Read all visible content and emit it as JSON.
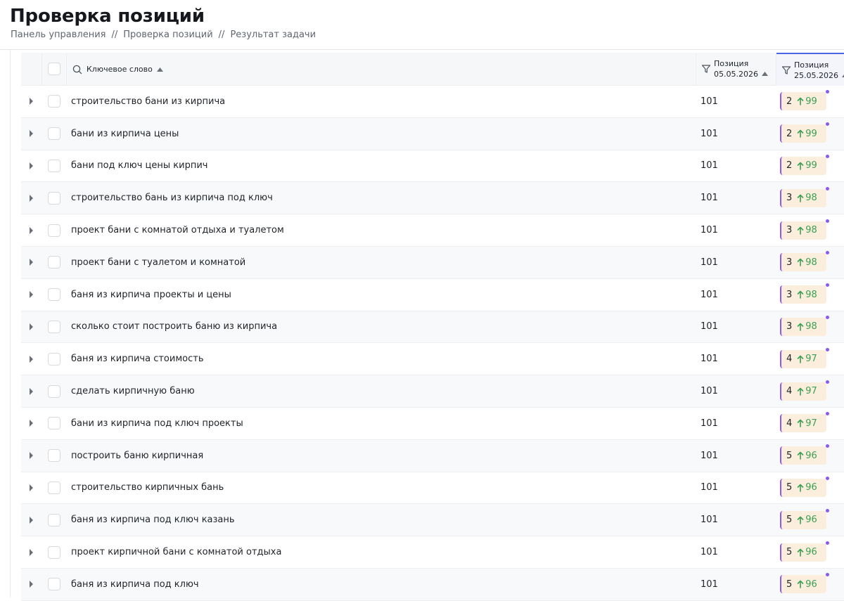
{
  "page": {
    "title": "Проверка позиций",
    "breadcrumb": [
      "Панель управления",
      "Проверка позиций",
      "Результат задачи"
    ],
    "breadcrumb_separator": "//"
  },
  "table": {
    "columns": {
      "keyword": "Ключевое слово",
      "pos1_title": "Позиция",
      "pos1_date": "05.05.2026",
      "pos2_title": "Позиция",
      "pos2_date": "25.05.2026"
    },
    "rows": [
      {
        "keyword": "строительство бани из кирпича",
        "pos1": "101",
        "pos2": "2",
        "delta": "99"
      },
      {
        "keyword": "бани из кирпича цены",
        "pos1": "101",
        "pos2": "2",
        "delta": "99"
      },
      {
        "keyword": "бани под ключ цены кирпич",
        "pos1": "101",
        "pos2": "2",
        "delta": "99"
      },
      {
        "keyword": "строительство бань из кирпича под ключ",
        "pos1": "101",
        "pos2": "3",
        "delta": "98"
      },
      {
        "keyword": "проект бани с комнатой отдыха и туалетом",
        "pos1": "101",
        "pos2": "3",
        "delta": "98"
      },
      {
        "keyword": "проект бани с туалетом и комнатой",
        "pos1": "101",
        "pos2": "3",
        "delta": "98"
      },
      {
        "keyword": "баня из кирпича проекты и цены",
        "pos1": "101",
        "pos2": "3",
        "delta": "98"
      },
      {
        "keyword": "сколько стоит построить баню из кирпича",
        "pos1": "101",
        "pos2": "3",
        "delta": "98"
      },
      {
        "keyword": "баня из кирпича стоимость",
        "pos1": "101",
        "pos2": "4",
        "delta": "97"
      },
      {
        "keyword": "сделать кирпичную баню",
        "pos1": "101",
        "pos2": "4",
        "delta": "97"
      },
      {
        "keyword": "бани из кирпича под ключ проекты",
        "pos1": "101",
        "pos2": "4",
        "delta": "97"
      },
      {
        "keyword": "построить баню кирпичная",
        "pos1": "101",
        "pos2": "5",
        "delta": "96"
      },
      {
        "keyword": "строительство кирпичных бань",
        "pos1": "101",
        "pos2": "5",
        "delta": "96"
      },
      {
        "keyword": "баня из кирпича под ключ казань",
        "pos1": "101",
        "pos2": "5",
        "delta": "96"
      },
      {
        "keyword": "проект кирпичной бани с комнатой отдыха",
        "pos1": "101",
        "pos2": "5",
        "delta": "96"
      },
      {
        "keyword": "баня из кирпича под ключ",
        "pos1": "101",
        "pos2": "5",
        "delta": "96"
      }
    ]
  },
  "icons": {
    "search": "search-icon",
    "filter": "filter-icon",
    "sort": "sort-asc-icon",
    "expand": "expand-caret-icon",
    "arrow_up": "arrow-up-icon"
  },
  "colors": {
    "accent": "#4a66e6",
    "badge_bg": "#fbeedd",
    "badge_marker": "#8a59f0",
    "delta_green": "#3aa055"
  }
}
